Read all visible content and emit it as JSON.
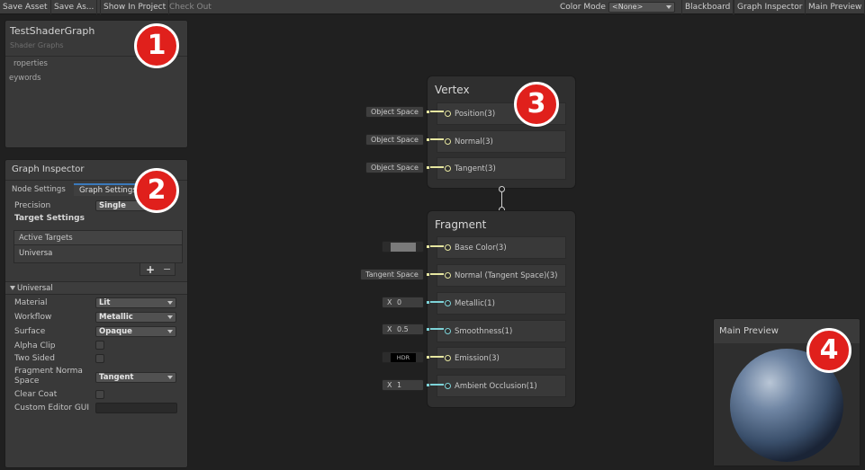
{
  "toolbar": {
    "save_asset": "Save Asset",
    "save_as": "Save As...",
    "show_in_project": "Show In Project",
    "check_out": "Check Out",
    "color_mode_label": "Color Mode",
    "color_mode_value": "<None>",
    "blackboard": "Blackboard",
    "graph_inspector": "Graph Inspector",
    "main_preview": "Main Preview"
  },
  "blackboard": {
    "title": "TestShaderGraph",
    "subtitle": "Shader Graphs",
    "properties": "roperties",
    "keywords": "eywords"
  },
  "inspector": {
    "title": "Graph Inspector",
    "tab_node": "Node Settings",
    "tab_graph": "Graph Settings",
    "precision_label": "Precision",
    "precision_value": "Single",
    "target_settings": "Target Settings",
    "active_targets": "Active Targets",
    "target_item": "Universa",
    "add": "+",
    "remove": "−",
    "universal_section": "Universal",
    "material_label": "Material",
    "material_value": "Lit",
    "workflow_label": "Workflow",
    "workflow_value": "Metallic",
    "surface_label": "Surface",
    "surface_value": "Opaque",
    "alpha_clip": "Alpha Clip",
    "two_sided": "Two Sided",
    "fragment_normal_label_1": "Fragment Norma",
    "fragment_normal_label_2": "Space",
    "fragment_normal_value": "Tangent",
    "clear_coat": "Clear Coat",
    "custom_editor_gui": "Custom Editor GUI"
  },
  "vertex": {
    "title": "Vertex",
    "slots": [
      {
        "label": "Position(3)",
        "input": "Object Space"
      },
      {
        "label": "Normal(3)",
        "input": "Object Space"
      },
      {
        "label": "Tangent(3)",
        "input": "Object Space"
      }
    ]
  },
  "fragment": {
    "title": "Fragment",
    "slots": [
      {
        "label": "Base Color(3)",
        "input": ""
      },
      {
        "label": "Normal (Tangent Space)(3)",
        "input": "Tangent Space"
      },
      {
        "label": "Metallic(1)",
        "input_x": "X",
        "input": "0"
      },
      {
        "label": "Smoothness(1)",
        "input_x": "X",
        "input": "0.5"
      },
      {
        "label": "Emission(3)",
        "input": "HDR"
      },
      {
        "label": "Ambient Occlusion(1)",
        "input_x": "X",
        "input": "1"
      }
    ]
  },
  "preview": {
    "title": "Main Preview"
  },
  "badges": [
    "1",
    "2",
    "3",
    "4"
  ],
  "colors": {
    "port_yellow": "#e6e6a0",
    "port_cyan": "#7dd3d8",
    "badge_red": "#e0201c",
    "base_color_swatch": "#7a7a7a"
  }
}
